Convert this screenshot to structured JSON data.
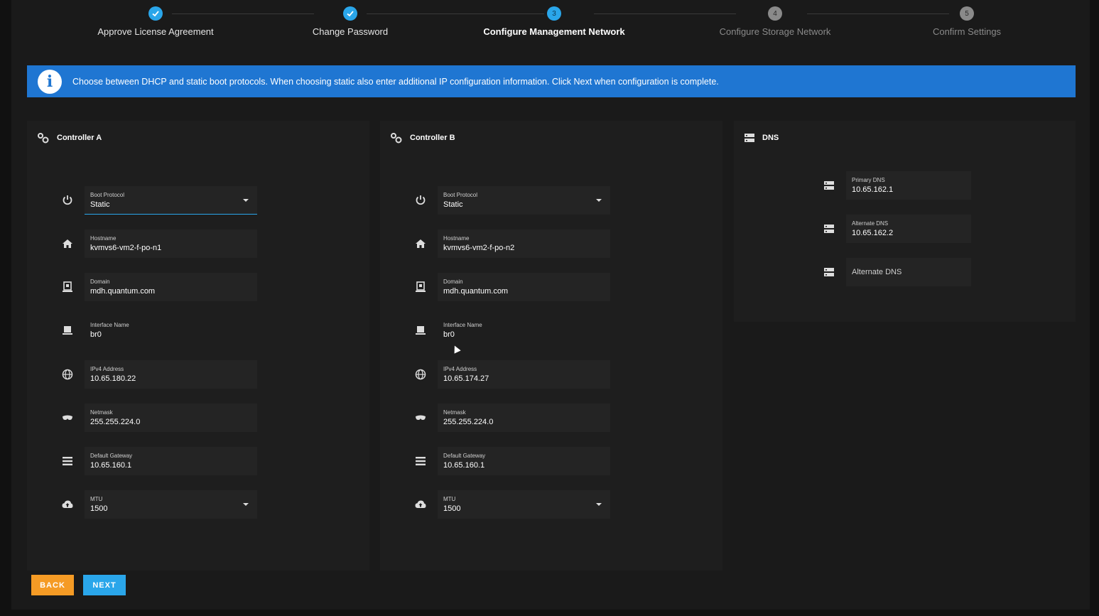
{
  "stepper": {
    "steps": [
      {
        "label": "Approve License Agreement",
        "state": "done",
        "number": "1"
      },
      {
        "label": "Change Password",
        "state": "done",
        "number": "2"
      },
      {
        "label": "Configure Management Network",
        "state": "active",
        "number": "3"
      },
      {
        "label": "Configure Storage Network",
        "state": "pending",
        "number": "4"
      },
      {
        "label": "Confirm Settings",
        "state": "pending",
        "number": "5"
      }
    ]
  },
  "banner": {
    "icon": "info-icon",
    "text": "Choose between DHCP and static boot protocols. When choosing static also enter additional IP configuration information. Click Next when configuration is complete."
  },
  "controller_a": {
    "title": "Controller A",
    "boot_protocol": {
      "label": "Boot Protocol",
      "value": "Static"
    },
    "hostname": {
      "label": "Hostname",
      "value": "kvmvs6-vm2-f-po-n1"
    },
    "domain": {
      "label": "Domain",
      "value": "mdh.quantum.com"
    },
    "interface": {
      "label": "Interface Name",
      "value": "br0"
    },
    "ipv4": {
      "label": "IPv4 Address",
      "value": "10.65.180.22"
    },
    "netmask": {
      "label": "Netmask",
      "value": "255.255.224.0"
    },
    "gateway": {
      "label": "Default Gateway",
      "value": "10.65.160.1"
    },
    "mtu": {
      "label": "MTU",
      "value": "1500"
    }
  },
  "controller_b": {
    "title": "Controller B",
    "boot_protocol": {
      "label": "Boot Protocol",
      "value": "Static"
    },
    "hostname": {
      "label": "Hostname",
      "value": "kvmvs6-vm2-f-po-n2"
    },
    "domain": {
      "label": "Domain",
      "value": "mdh.quantum.com"
    },
    "interface": {
      "label": "Interface Name",
      "value": "br0"
    },
    "ipv4": {
      "label": "IPv4 Address",
      "value": "10.65.174.27"
    },
    "netmask": {
      "label": "Netmask",
      "value": "255.255.224.0"
    },
    "gateway": {
      "label": "Default Gateway",
      "value": "10.65.160.1"
    },
    "mtu": {
      "label": "MTU",
      "value": "1500"
    }
  },
  "dns": {
    "title": "DNS",
    "primary": {
      "label": "Primary DNS",
      "value": "10.65.162.1"
    },
    "alternate1": {
      "label": "Alternate DNS",
      "value": "10.65.162.2"
    },
    "alternate2": {
      "placeholder": "Alternate DNS"
    }
  },
  "buttons": {
    "back": "BACK",
    "next": "NEXT"
  },
  "colors": {
    "accent": "#2aa6ea",
    "banner": "#1f76d2",
    "back": "#f59b25",
    "background": "#1a1a1a",
    "panel": "#1e1e1e"
  }
}
